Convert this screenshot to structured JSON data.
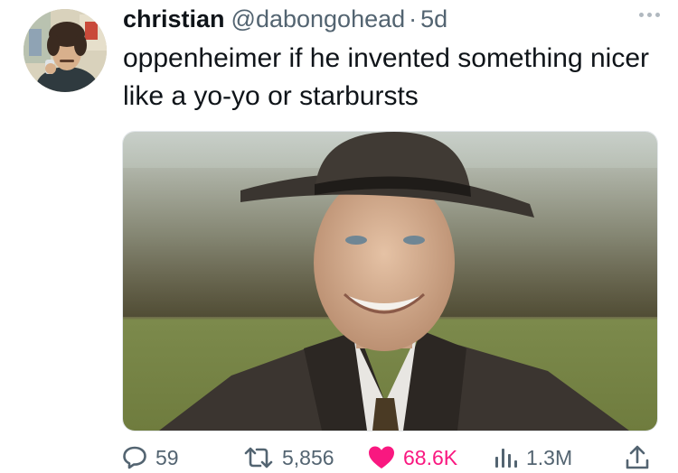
{
  "tweet": {
    "author_name": "christian",
    "handle": "@dabongohead",
    "separator": "·",
    "time": "5d",
    "text": "oppenheimer if he invented something nicer like a yo-yo or starbursts"
  },
  "actions": {
    "replies": "59",
    "retweets": "5,856",
    "likes": "68.6K",
    "views": "1.3M"
  },
  "icons": {
    "reply": "reply-icon",
    "retweet": "retweet-icon",
    "like": "heart-icon",
    "views": "views-chart-icon",
    "share": "share-icon",
    "more": "more-options-icon"
  },
  "colors": {
    "text": "#0f1419",
    "secondary": "#536471",
    "like": "#f91880"
  }
}
